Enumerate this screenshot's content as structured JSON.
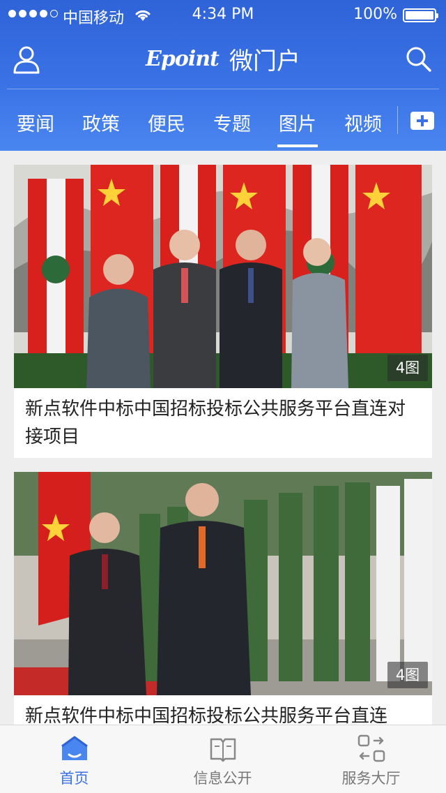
{
  "status_bar": {
    "carrier": "中国移动",
    "time": "4:34 PM",
    "battery": "100%"
  },
  "navbar": {
    "logo_text": "Epoint",
    "title": "微门户",
    "left_icon": "user-icon",
    "right_icon": "search-icon"
  },
  "tabs": [
    {
      "label": "要闻",
      "active": false
    },
    {
      "label": "政策",
      "active": false
    },
    {
      "label": "便民",
      "active": false
    },
    {
      "label": "专题",
      "active": false
    },
    {
      "label": "图片",
      "active": true
    },
    {
      "label": "视频",
      "active": false
    }
  ],
  "feed": [
    {
      "title": "新点软件中标中国招标投标公共服务平台直连对接项目",
      "count": "4图"
    },
    {
      "title": "新点软件中标中国招标投标公共服务平台直连",
      "count": "4图"
    }
  ],
  "tabbar": [
    {
      "label": "首页",
      "icon": "home-icon",
      "active": true
    },
    {
      "label": "信息公开",
      "icon": "open-book-icon",
      "active": false
    },
    {
      "label": "服务大厅",
      "icon": "service-hall-icon",
      "active": false
    }
  ],
  "colors": {
    "header_blue": "#3a72e6",
    "active_tab": "#3a72e6",
    "background": "#eeeeef"
  }
}
